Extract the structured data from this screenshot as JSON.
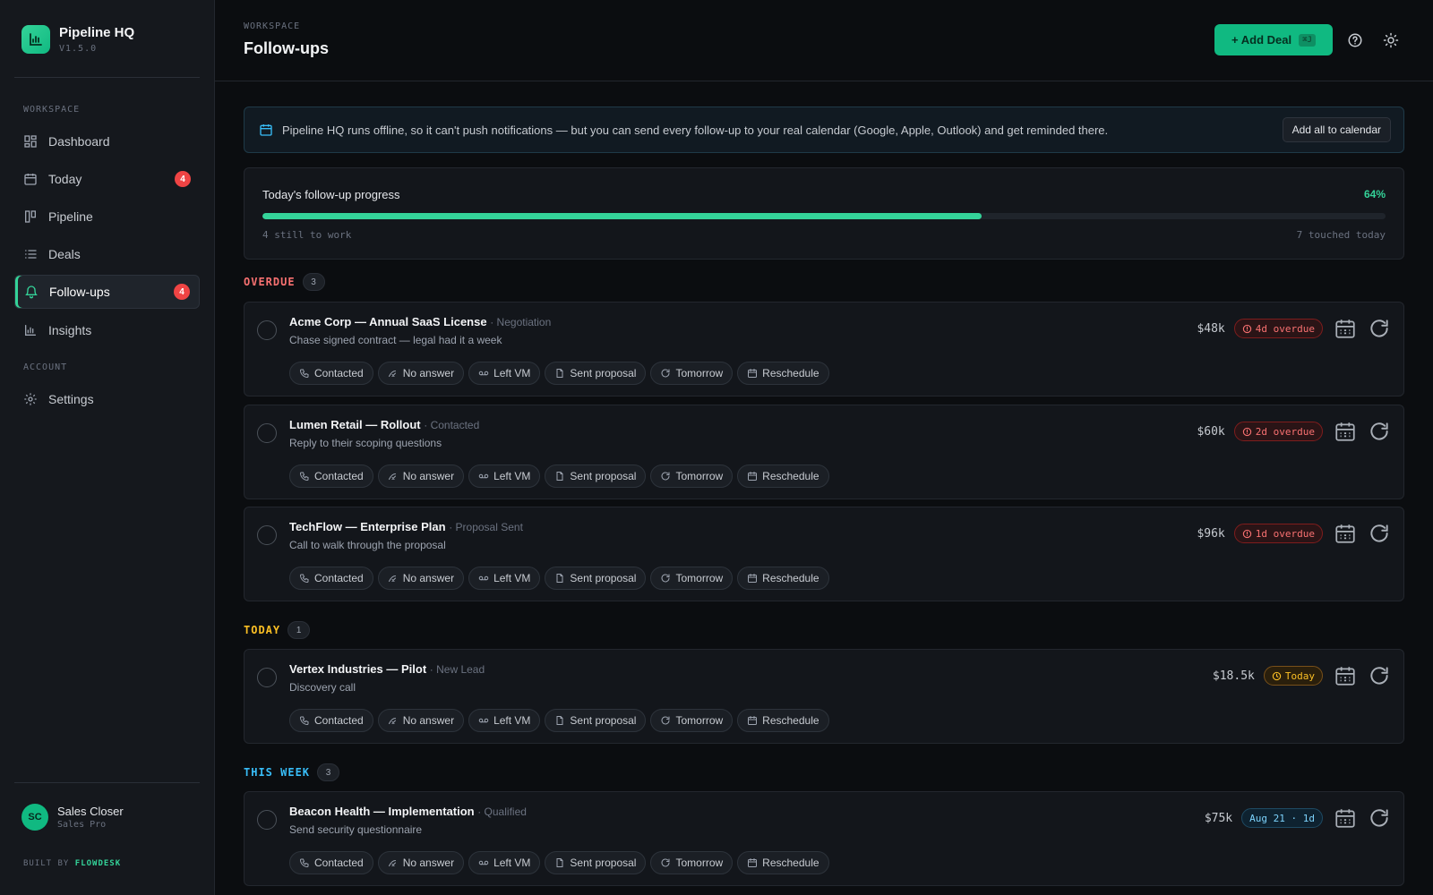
{
  "app": {
    "name": "Pipeline HQ",
    "version": "V1.5.0"
  },
  "sidebar": {
    "workspace_label": "WORKSPACE",
    "account_label": "ACCOUNT",
    "items": [
      {
        "label": "Dashboard",
        "icon": "dashboard-icon"
      },
      {
        "label": "Today",
        "icon": "calendar-icon",
        "badge": "4"
      },
      {
        "label": "Pipeline",
        "icon": "pipeline-icon"
      },
      {
        "label": "Deals",
        "icon": "list-icon"
      },
      {
        "label": "Follow-ups",
        "icon": "bell-icon",
        "badge": "4",
        "active": true
      },
      {
        "label": "Insights",
        "icon": "chart-icon"
      }
    ],
    "settings_label": "Settings",
    "user": {
      "initials": "SC",
      "name": "Sales Closer",
      "plan": "Sales Pro"
    },
    "built_by_prefix": "BUILT BY ",
    "built_by_name": "FLOWDESK"
  },
  "header": {
    "breadcrumb": "WORKSPACE",
    "title": "Follow-ups",
    "add_deal_label": "+ Add Deal",
    "add_deal_shortcut": "⌘J"
  },
  "banner": {
    "text": "Pipeline HQ runs offline, so it can't push notifications — but you can send every follow-up to your real calendar (Google, Apple, Outlook) and get reminded there.",
    "button_label": "Add all to calendar"
  },
  "progress": {
    "title": "Today's follow-up progress",
    "percent_label": "64%",
    "fraction": 0.64,
    "remaining": "4 still to work",
    "touched": "7 touched today"
  },
  "chip_labels": [
    "Contacted",
    "No answer",
    "Left VM",
    "Sent proposal",
    "Tomorrow",
    "Reschedule"
  ],
  "groups": {
    "overdue": {
      "label": "OVERDUE",
      "count": "3"
    },
    "today": {
      "label": "TODAY",
      "count": "1"
    },
    "week": {
      "label": "THIS WEEK",
      "count": "3"
    }
  },
  "colors": {
    "accent": "#34d399",
    "overdue": "#f87171",
    "today": "#fbbf24",
    "week": "#38bdf8"
  },
  "followups": [
    {
      "name": "Acme Corp — Annual SaaS License",
      "stage": "· Negotiation",
      "note": "Chase signed contract — legal had it a week",
      "amount": "$48k",
      "status": "4d overdue",
      "kind": "overdue"
    },
    {
      "name": "Lumen Retail — Rollout",
      "stage": "· Contacted",
      "note": "Reply to their scoping questions",
      "amount": "$60k",
      "status": "2d overdue",
      "kind": "overdue"
    },
    {
      "name": "TechFlow — Enterprise Plan",
      "stage": "· Proposal Sent",
      "note": "Call to walk through the proposal",
      "amount": "$96k",
      "status": "1d overdue",
      "kind": "overdue"
    },
    {
      "name": "Vertex Industries — Pilot",
      "stage": "· New Lead",
      "note": "Discovery call",
      "amount": "$18.5k",
      "status": "Today",
      "kind": "today"
    },
    {
      "name": "Beacon Health — Implementation",
      "stage": "· Qualified",
      "note": "Send security questionnaire",
      "amount": "$75k",
      "status": "Aug 21 · 1d",
      "kind": "week"
    }
  ]
}
